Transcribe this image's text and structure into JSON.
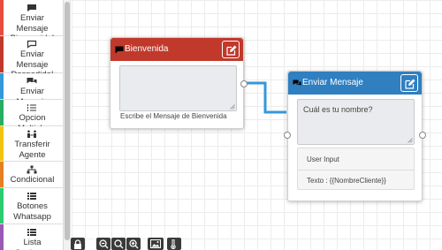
{
  "sidebar": {
    "items": [
      {
        "label": "Enviar Mensaje Bienvenida!",
        "icon": "comment-icon",
        "color": "#e74c3c"
      },
      {
        "label": "Enviar Mensaje Despedida!",
        "icon": "comment-outline-icon",
        "color": "#c0392b"
      },
      {
        "label": "Enviar Mensaje",
        "icon": "comments-icon",
        "color": "#3498db"
      },
      {
        "label": "Opcion Multiple",
        "icon": "list-ol-icon",
        "color": "#27ae60"
      },
      {
        "label": "Transferir Agente",
        "icon": "people-arrows-icon",
        "color": "#f1c40f"
      },
      {
        "label": "Condicional",
        "icon": "sitemap-icon",
        "color": "#e67e22"
      },
      {
        "label": "Botones Whatsapp",
        "icon": "list-icon",
        "color": "#2ecc71"
      },
      {
        "label": "Lista Opciones",
        "icon": "list-icon",
        "color": "#9b59b6"
      }
    ]
  },
  "nodes": {
    "bienvenida": {
      "title": "Bienvenida",
      "header_color": "#c0392b",
      "textarea_value": "",
      "caption": "Escribe el Mensaje de Bienvenida"
    },
    "enviar": {
      "title": "Enviar Mensaje",
      "header_color": "#2f7fc1",
      "textarea_value": "Cuál es tu nombre?",
      "user_input_label": "User Input",
      "texto_label": "Texto : {{NombreCliente}}"
    }
  },
  "toolbar": {
    "buttons": [
      "lock-icon",
      "zoom-out-icon",
      "zoom-reset-icon",
      "zoom-in-icon",
      "image-icon",
      "thermometer-icon"
    ]
  },
  "colors": {
    "connector": "#3498db"
  }
}
